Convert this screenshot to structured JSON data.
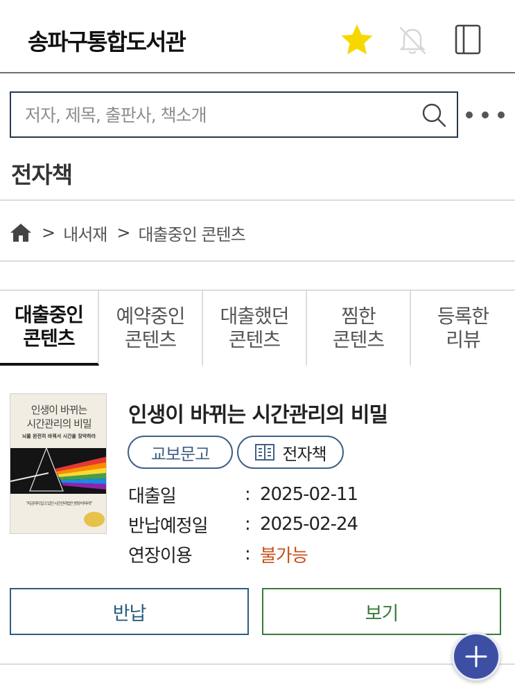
{
  "header": {
    "title": "송파구통합도서관",
    "icons": [
      "star-icon",
      "bell-off-icon",
      "book-icon"
    ],
    "star_color": "#f6d800"
  },
  "search": {
    "placeholder": "저자, 제목, 출판사, 책소개",
    "value": ""
  },
  "section": {
    "title": "전자책"
  },
  "breadcrumb": {
    "icon": "home-icon",
    "items": [
      "내서재",
      "대출중인 콘텐츠"
    ],
    "separator": ">"
  },
  "tabs": [
    {
      "line1": "대출중인",
      "line2": "콘텐츠",
      "active": true
    },
    {
      "line1": "예약중인",
      "line2": "콘텐츠",
      "active": false
    },
    {
      "line1": "대출했던",
      "line2": "콘텐츠",
      "active": false
    },
    {
      "line1": "찜한",
      "line2": "콘텐츠",
      "active": false
    },
    {
      "line1": "등록한",
      "line2": "리뷰",
      "active": false
    }
  ],
  "book": {
    "title": "인생이 바뀌는 시간관리의 비밀",
    "cover": {
      "title_line1": "인생이 바뀌는",
      "title_line2": "시간관리의 비밀",
      "subtitle": "뇌를 완전히 바꿔서 시간을 장악하라",
      "quote": "\"지금까지 알고 있던 시간관리법은 몽땅 버려라!\""
    },
    "publisher": "교보문고",
    "type_label": "전자책",
    "type_icon": "ebook-icon",
    "loan_date_label": "대출일",
    "loan_date": "2025-02-11",
    "due_date_label": "반납예정일",
    "due_date": "2025-02-24",
    "renew_label": "연장이용",
    "renew_value": "불가능",
    "colon": ":"
  },
  "actions": {
    "return_label": "반납",
    "view_label": "보기"
  },
  "colors": {
    "accent_border": "#26384d",
    "return_color": "#2b5d80",
    "view_color": "#3a7a3a",
    "warning": "#c8511b",
    "fab": "#3d4fa3"
  }
}
